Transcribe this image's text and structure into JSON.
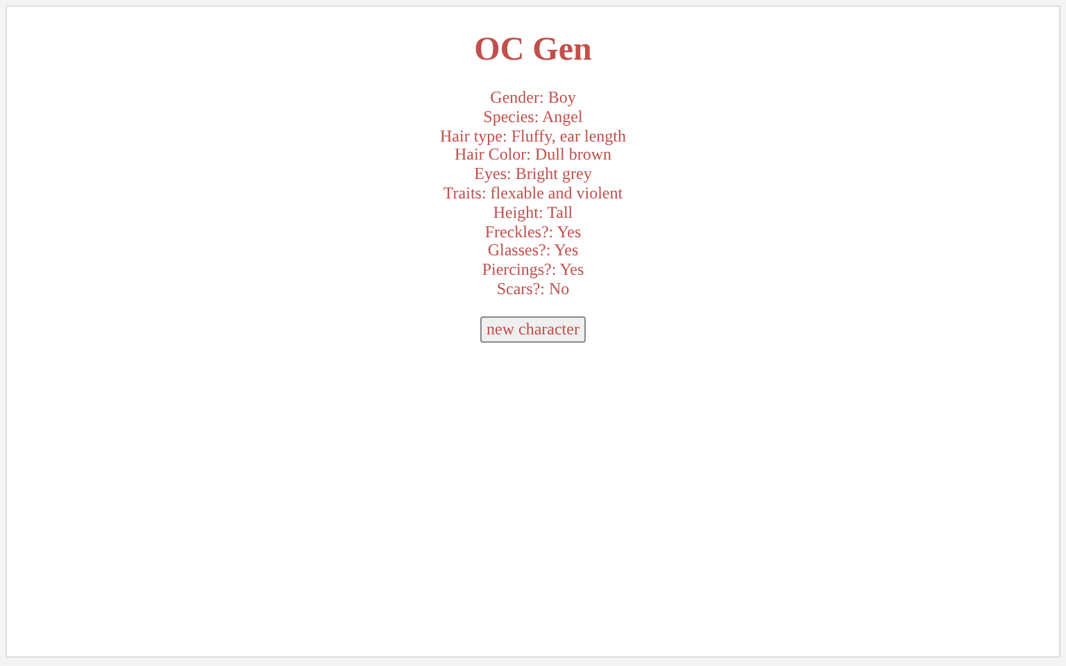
{
  "title": "OC Gen",
  "traits": [
    "Gender: Boy",
    "Species: Angel",
    "Hair type: Fluffy, ear length",
    "Hair Color: Dull brown",
    "Eyes: Bright grey",
    "Traits: flexable and violent",
    "Height: Tall",
    "Freckles?: Yes",
    "Glasses?: Yes",
    "Piercings?: Yes",
    "Scars?: No"
  ],
  "button": "new character"
}
